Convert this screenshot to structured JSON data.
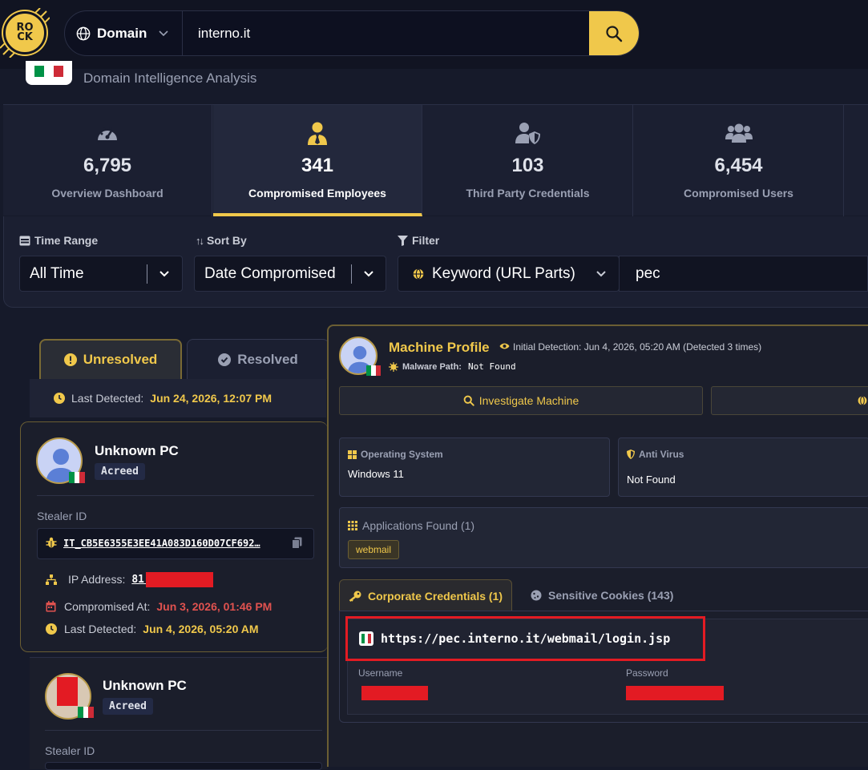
{
  "logo": {
    "line1": "RO",
    "line2": "CK"
  },
  "search": {
    "type_label": "Domain",
    "value": "interno.it"
  },
  "header": {
    "subtitle": "Domain Intelligence Analysis"
  },
  "stats": [
    {
      "value": "6,795",
      "label": "Overview Dashboard",
      "icon": "gauge-icon"
    },
    {
      "value": "341",
      "label": "Compromised Employees",
      "icon": "user-tie-icon"
    },
    {
      "value": "103",
      "label": "Third Party Credentials",
      "icon": "user-shield-icon"
    },
    {
      "value": "6,454",
      "label": "Compromised Users",
      "icon": "users-icon"
    }
  ],
  "filters": {
    "time_range_label": "Time Range",
    "time_range_value": "All Time",
    "sort_by_label": "Sort By",
    "sort_by_value": "Date Compromised",
    "filter_label": "Filter",
    "filter_type": "Keyword (URL Parts)",
    "filter_value": "pec"
  },
  "tabs": {
    "unresolved": "Unresolved",
    "resolved": "Resolved"
  },
  "top_last_detected": {
    "label": "Last Detected:",
    "value": "Jun 24, 2026, 12:07 PM"
  },
  "machines": [
    {
      "name": "Unknown PC",
      "badge": "Acreed",
      "stealer_id_label": "Stealer ID",
      "stealer_id": "IT_CB5E6355E3EE41A083D160D07CF692…",
      "ip_label": "IP Address:",
      "ip_value": "81.",
      "compromised_label": "Compromised At:",
      "compromised_value": "Jun 3, 2026, 01:46 PM",
      "last_detected_label": "Last Detected:",
      "last_detected_value": "Jun 4, 2026, 05:20 AM"
    },
    {
      "name": "Unknown PC",
      "badge": "Acreed",
      "stealer_id_label": "Stealer ID"
    }
  ],
  "profile": {
    "title": "Machine Profile",
    "initial_detection": "Initial Detection: Jun 4, 2026, 05:20 AM (Detected 3 times)",
    "malware_path_label": "Malware Path:",
    "malware_path_value": "Not Found",
    "investigate_label": "Investigate Machine",
    "os_label": "Operating System",
    "os_value": "Windows 11",
    "av_label": "Anti Virus",
    "av_value": "Not Found",
    "apps_label": "Applications Found (1)",
    "apps": [
      "webmail"
    ],
    "cred_tab": "Corporate Credentials (1)",
    "cookies_tab": "Sensitive Cookies (143)",
    "url": "https://pec.interno.it/webmail/login.jsp",
    "username_label": "Username",
    "password_label": "Password"
  },
  "colors": {
    "accent": "#f0c84b",
    "background": "#161a2a",
    "redaction": "#e31b23",
    "date_red": "#e0524f"
  }
}
